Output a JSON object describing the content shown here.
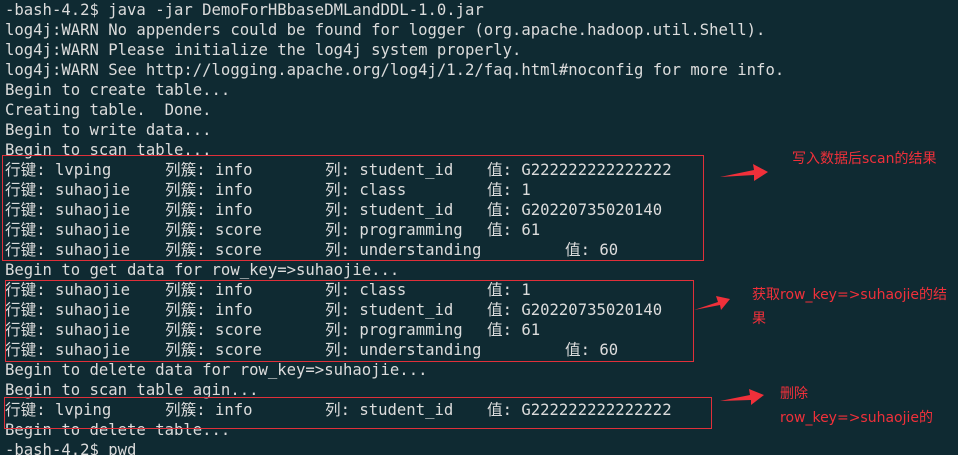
{
  "terminal": {
    "lines": [
      "-bash-4.2$ java -jar DemoForHBbaseDMLandDDL-1.0.jar",
      "log4j:WARN No appenders could be found for logger (org.apache.hadoop.util.Shell).",
      "log4j:WARN Please initialize the log4j system properly.",
      "log4j:WARN See http://logging.apache.org/log4j/1.2/faq.html#noconfig for more info.",
      "Begin to create table...",
      "Creating table.  Done.",
      "Begin to write data...",
      "Begin to scan table...",
      "Begin to get data for row_key=>suhaojie...",
      "Begin to delete data for row_key=>suhaojie...",
      "Begin to scan table agin...",
      "Begin to delete table...",
      "-bash-4.2$ pwd"
    ],
    "scan_rows": [
      {
        "row": "行键: lvping",
        "family": "列簇: info",
        "column": "列: student_id",
        "value": "值: G222222222222222"
      },
      {
        "row": "行键: suhaojie",
        "family": "列簇: info",
        "column": "列: class",
        "value": "值: 1"
      },
      {
        "row": "行键: suhaojie",
        "family": "列簇: info",
        "column": "列: student_id",
        "value": "值: G20220735020140"
      },
      {
        "row": "行键: suhaojie",
        "family": "列簇: score",
        "column": "列: programming",
        "value": "值: 61"
      },
      {
        "row": "行键: suhaojie",
        "family": "列簇: score",
        "column": "列: understanding",
        "value": "值: 60"
      }
    ],
    "get_rows": [
      {
        "row": "行键: suhaojie",
        "family": "列簇: info",
        "column": "列: class",
        "value": "值: 1"
      },
      {
        "row": "行键: suhaojie",
        "family": "列簇: info",
        "column": "列: student_id",
        "value": "值: G20220735020140"
      },
      {
        "row": "行键: suhaojie",
        "family": "列簇: score",
        "column": "列: programming",
        "value": "值: 61"
      },
      {
        "row": "行键: suhaojie",
        "family": "列簇: score",
        "column": "列: understanding",
        "value": "值: 60"
      }
    ],
    "rescan_rows": [
      {
        "row": "行键: lvping",
        "family": "列簇: info",
        "column": "列: student_id",
        "value": "值: G222222222222222"
      }
    ]
  },
  "annotations": {
    "scan_note": "写入数据后scan的结果",
    "get_note": "获取row_key=>suhaojie的结果",
    "delete_note_line1": "删除",
    "delete_note_line2": "row_key=>suhaojie的"
  },
  "colors": {
    "background": "#0f2a32",
    "text": "#dcdcdc",
    "annotation": "#f0303a"
  }
}
